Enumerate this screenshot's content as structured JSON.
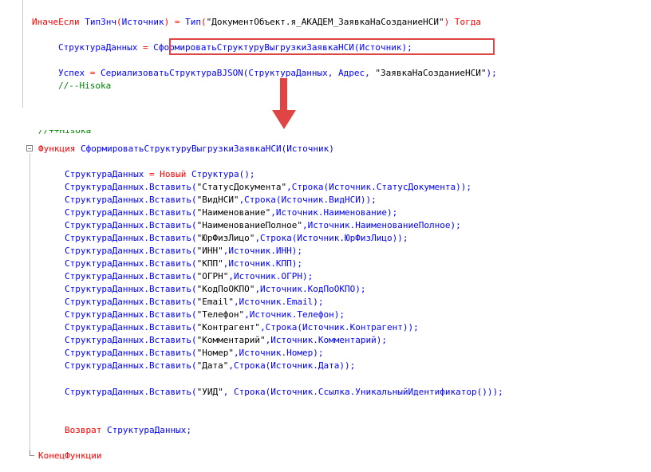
{
  "editor": {
    "top_block": {
      "line1": {
        "kw_elseif": "ИначеЕсли",
        "fn_typeof": "ТипЗнч",
        "paren_open": "(",
        "arg_source": "Источник",
        "mid": ") = ",
        "fn_type": "Тип",
        "paren_open2": "(",
        "type_name": "\"ДокументОбъект.я_АКАДЕМ_ЗаявкаНаСозданиеНСИ\"",
        "paren_close": ")",
        "kw_then": "Тогда"
      },
      "line2": {
        "var": "СтруктураДанных",
        "op": " = ",
        "call": "СформироватьСтруктуруВыгрузкиЗаявкаНСИ(Источник);"
      },
      "line3": {
        "var": "Успех",
        "op": " = ",
        "call_a": "СериализоватьСтруктураВJSON(СтруктураДанных, Адрес, ",
        "str": "\"ЗаявкаНаСозданиеНСИ\"",
        "end": ");"
      },
      "line4_comment": "//--Hisoka"
    },
    "bottom_block": {
      "partial_comment": "//++Hisoka",
      "func_header": {
        "kw_function": "Функция",
        "name": "СформироватьСтруктуруВыгрузкиЗаявкаНСИ(Источник)"
      },
      "line_new": {
        "var": "СтруктураДанных",
        "op": " = ",
        "kw_new": "Новый",
        "type": " Структура();"
      },
      "inserts": [
        {
          "prefix": "СтруктураДанных.Вставить(",
          "key": "\"СтатусДокумента\"",
          "value": ",Строка(Источник.СтатусДокумента));"
        },
        {
          "prefix": "СтруктураДанных.Вставить(",
          "key": "\"ВидНСИ\"",
          "value": ",Строка(Источник.ВидНСИ));"
        },
        {
          "prefix": "СтруктураДанных.Вставить(",
          "key": "\"Наименование\"",
          "value": ",Источник.Наименование);"
        },
        {
          "prefix": "СтруктураДанных.Вставить(",
          "key": "\"НаименованиеПолное\"",
          "value": ",Источник.НаименованиеПолное);"
        },
        {
          "prefix": "СтруктураДанных.Вставить(",
          "key": "\"ЮрФизЛицо\"",
          "value": ",Строка(Источник.ЮрФизЛицо));"
        },
        {
          "prefix": "СтруктураДанных.Вставить(",
          "key": "\"ИНН\"",
          "value": ",Источник.ИНН);"
        },
        {
          "prefix": "СтруктураДанных.Вставить(",
          "key": "\"КПП\"",
          "value": ",Источник.КПП);"
        },
        {
          "prefix": "СтруктураДанных.Вставить(",
          "key": "\"ОГРН\"",
          "value": ",Источник.ОГРН);"
        },
        {
          "prefix": "СтруктураДанных.Вставить(",
          "key": "\"КодПоОКПО\"",
          "value": ",Источник.КодПоОКПО);"
        },
        {
          "prefix": "СтруктураДанных.Вставить(",
          "key": "\"Email\"",
          "value": ",Источник.Email);"
        },
        {
          "prefix": "СтруктураДанных.Вставить(",
          "key": "\"Телефон\"",
          "value": ",Источник.Телефон);"
        },
        {
          "prefix": "СтруктураДанных.Вставить(",
          "key": "\"Контрагент\"",
          "value": ",Строка(Источник.Контрагент));"
        },
        {
          "prefix": "СтруктураДанных.Вставить(",
          "key": "\"Комментарий\"",
          "value": ",Источник.Комментарий);"
        },
        {
          "prefix": "СтруктураДанных.Вставить(",
          "key": "\"Номер\"",
          "value": ",Источник.Номер);"
        },
        {
          "prefix": "СтруктураДанных.Вставить(",
          "key": "\"Дата\"",
          "value": ",Строка(Источник.Дата));"
        }
      ],
      "uid_line": {
        "prefix": "СтруктураДанных.Вставить(",
        "key": "\"УИД\"",
        "value": ", Строка(Источник.Ссылка.УникальныйИдентификатор()));"
      },
      "return_line": {
        "kw_return": "Возврат",
        "rest": " СтруктураДанных;"
      },
      "end_function": "КонецФункции"
    }
  },
  "colors": {
    "keyword": "#ff0000",
    "identifier": "#0000ff",
    "string": "#000000",
    "comment": "#008000",
    "annotation": "#e04545"
  }
}
